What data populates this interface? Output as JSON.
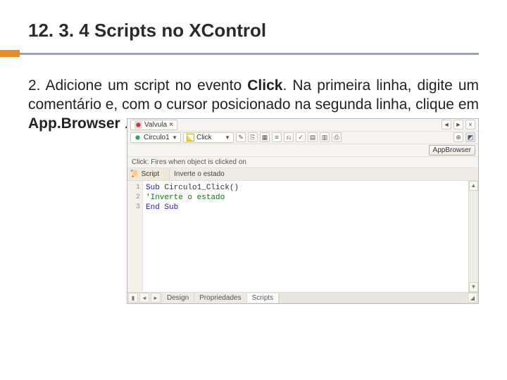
{
  "slide": {
    "title": "12. 3. 4 Scripts no XControl",
    "body_prefix": "2. Adicione um script no evento ",
    "body_bold1": "Click",
    "body_mid": ". Na primeira linha, digite um comentário e, com o cursor posicionado na segunda linha, clique em ",
    "body_bold2": "App.Browser",
    "body_suffix": " ."
  },
  "ide": {
    "tab": {
      "label": "Valvula"
    },
    "object_dd": "Circulo1",
    "event_dd": "Click",
    "appbrowser_label": "AppBrowser",
    "event_desc": "Click: Fires when object is clicked on",
    "script_col": "Script",
    "script_desc": "Inverte o estado",
    "gutter": [
      "1",
      "2",
      "3"
    ],
    "code": {
      "l1a": "Sub",
      "l1b": " Circulo1_Click()",
      "l2": "'Inverte o estado",
      "l3": "End Sub"
    },
    "footer_tabs": [
      "Design",
      "Propriedades",
      "Scripts"
    ]
  }
}
